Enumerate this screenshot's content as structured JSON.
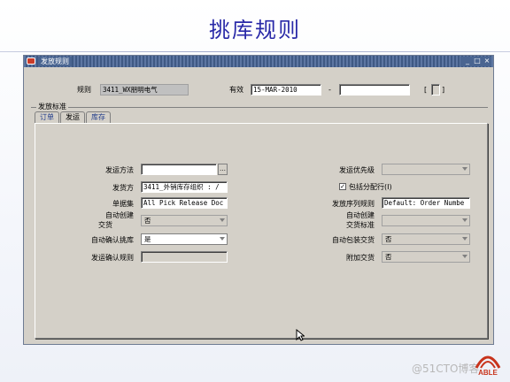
{
  "slide": {
    "title": "挑库规则"
  },
  "window": {
    "title": "发放规则",
    "controls": {
      "minimize": "_",
      "maximize": "□",
      "close": "×"
    }
  },
  "header": {
    "rule_label": "规则",
    "rule_value": "3411_WX朋明电气",
    "effective_label": "有效",
    "effective_from": "15-MAR-2010",
    "dash": "-",
    "effective_to": "",
    "bracket_left": "[",
    "bracket_right": "]"
  },
  "group": {
    "label": "发放标准"
  },
  "tabs": [
    {
      "label": "订单",
      "active": false
    },
    {
      "label": "发运",
      "active": true
    },
    {
      "label": "库存",
      "active": false
    }
  ],
  "form_left": {
    "ship_method_label": "发运方法",
    "ship_method_value": "",
    "lov_glyph": "…",
    "ship_from_label": "发货方",
    "ship_from_value": "3411_外销库存组织 : /",
    "doc_set_label": "单据集",
    "doc_set_value": "All Pick Release Doc",
    "auto_create_label_1": "自动创建",
    "auto_create_label_2": "交货",
    "auto_create_value": "否",
    "auto_pick_confirm_label": "自动确认挑库",
    "auto_pick_confirm_value": "是",
    "ship_confirm_rule_label": "发运确认规则",
    "ship_confirm_rule_value": ""
  },
  "form_right": {
    "ship_priority_label": "发运优先级",
    "ship_priority_value": "",
    "include_backorders_label": "包括分配行(I)",
    "include_backorders_checked": true,
    "release_seq_label": "发放序列规则",
    "release_seq_value": "Default: Order Numbe",
    "auto_create_criteria_label_1": "自动创建",
    "auto_create_criteria_label_2": "交货标准",
    "auto_create_criteria_value": "",
    "auto_pack_label": "自动包装交货",
    "auto_pack_value": "否",
    "append_deliveries_label": "附加交货",
    "append_deliveries_value": "否"
  },
  "branding": {
    "logo_text": "ABLE",
    "watermark": "@51CTO博客"
  },
  "colors": {
    "title": "#2a2aa8",
    "titlebar": "#4a6591",
    "window_bg": "#d4d0c8",
    "logo": "#c8341c"
  }
}
